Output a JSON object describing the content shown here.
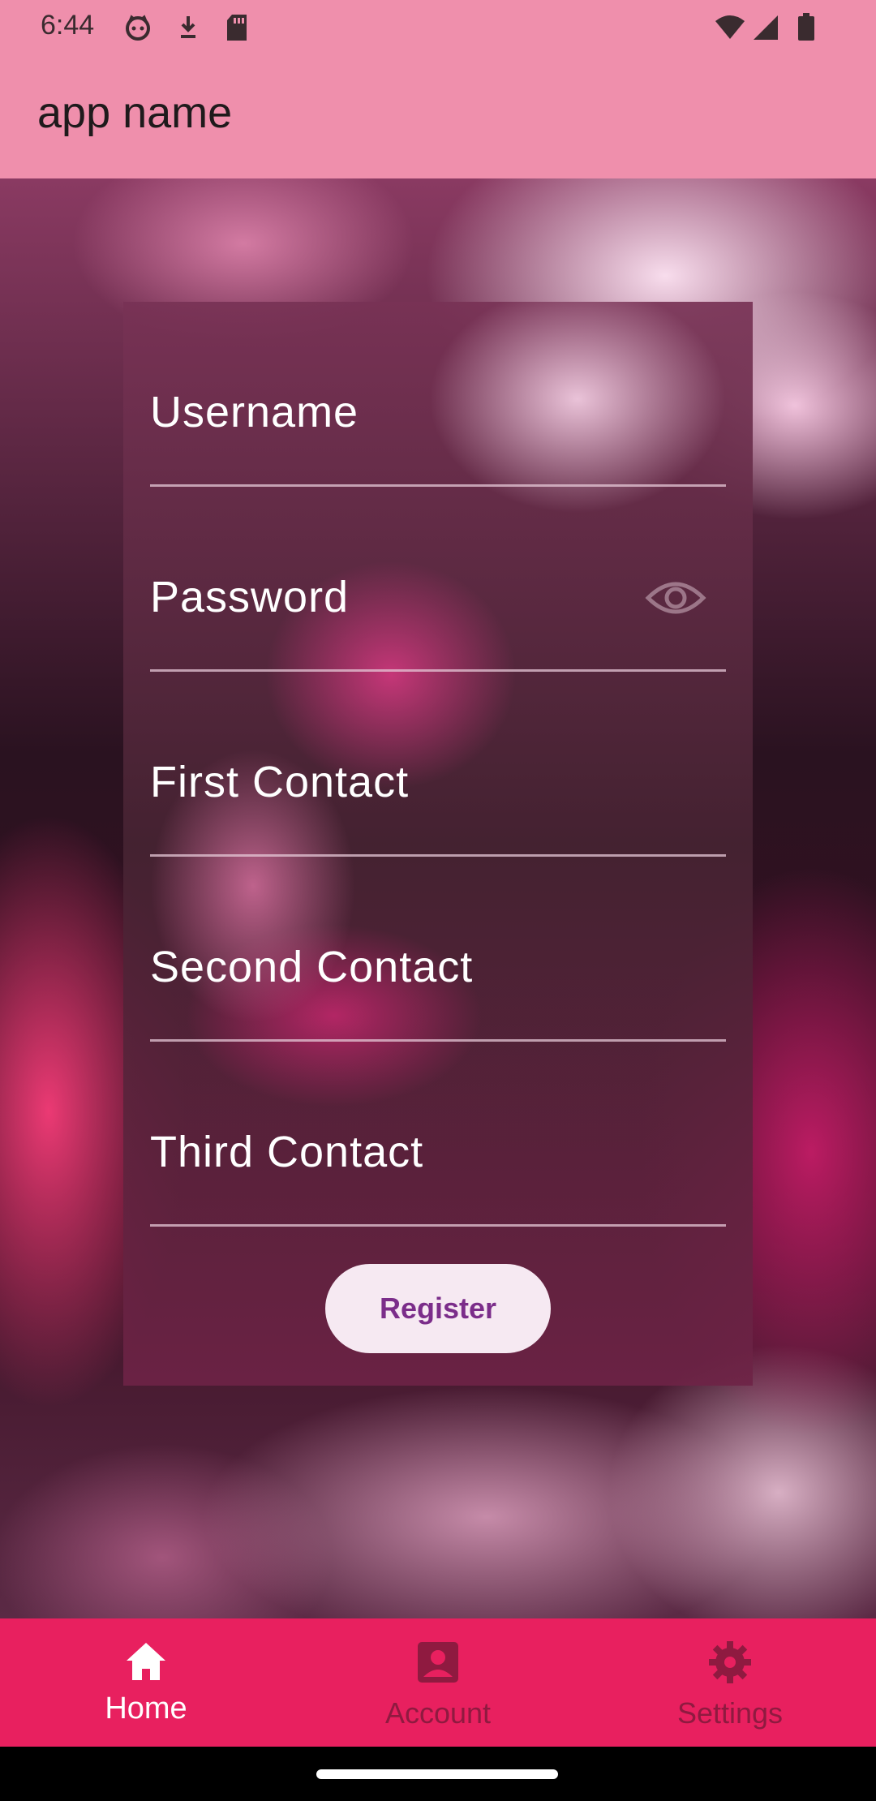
{
  "status_bar": {
    "time": "6:44",
    "left_icons": [
      "cat-face-icon",
      "download-icon",
      "sd-card-icon"
    ],
    "right_icons": [
      "wifi-icon",
      "signal-icon",
      "battery-icon"
    ]
  },
  "app_bar": {
    "title": "app name"
  },
  "form": {
    "fields": [
      {
        "label": "Username"
      },
      {
        "label": "Password",
        "trailing_icon": "eye-icon"
      },
      {
        "label": "First Contact"
      },
      {
        "label": "Second Contact"
      },
      {
        "label": "Third Contact"
      }
    ],
    "register_label": "Register"
  },
  "bottom_nav": {
    "items": [
      {
        "label": "Home",
        "icon": "home-icon",
        "active": true
      },
      {
        "label": "Account",
        "icon": "account-icon",
        "active": false
      },
      {
        "label": "Settings",
        "icon": "gear-icon",
        "active": false
      }
    ]
  },
  "colors": {
    "app_bar": "#ef8fac",
    "bottom_nav": "#e8205f",
    "register_button_bg": "#f6e9f2",
    "register_button_text": "#7b2d8a"
  }
}
